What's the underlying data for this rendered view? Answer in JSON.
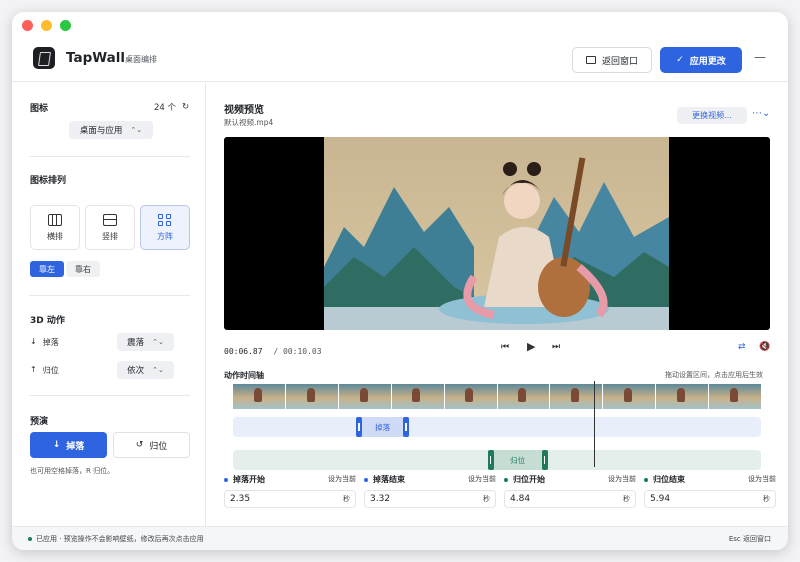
{
  "app": {
    "name": "TapWall",
    "subtitle": "桌面编排"
  },
  "header": {
    "back_label": "返回窗口",
    "apply_label": "应用更改",
    "more": "—"
  },
  "sidebar": {
    "icons_title": "图标",
    "icons_count": "24 个",
    "scope_select": "桌面与应用",
    "layout_title": "图标排列",
    "layouts": [
      {
        "label": "横排",
        "icon": "columns-icon"
      },
      {
        "label": "竖排",
        "icon": "rows-icon"
      },
      {
        "label": "方阵",
        "icon": "grid-icon"
      }
    ],
    "align": [
      "靠左",
      "靠右"
    ],
    "motion_title": "3D 动作",
    "drop_label": "掉落",
    "drop_value": "震落",
    "restore_label": "归位",
    "restore_value": "依次",
    "preview_title": "预演",
    "drop_button": "掉落",
    "restore_button": "归位",
    "hint": "也可用空格掉落，R 归位。"
  },
  "main": {
    "preview_title": "视频预览",
    "file_name": "默认视频.mp4",
    "change_button": "更换视频...",
    "time_current": "00:06.87",
    "time_total": "/ 00:10.03",
    "timeline_title": "动作时间轴",
    "timeline_hint": "拖动设置区间，点击应用后生效",
    "drop_clip": "掉落",
    "restore_clip": "归位",
    "playhead_fraction": 0.684,
    "drop_clip_range": [
      0.235,
      0.332
    ],
    "restore_clip_range": [
      0.484,
      0.594
    ],
    "fields": [
      {
        "label": "掉落开始",
        "set": "设为当前",
        "value": "2.35",
        "unit": "秒",
        "color": "#2f64e0"
      },
      {
        "label": "掉落结束",
        "set": "设为当前",
        "value": "3.32",
        "unit": "秒",
        "color": "#2f64e0"
      },
      {
        "label": "归位开始",
        "set": "设为当前",
        "value": "4.84",
        "unit": "秒",
        "color": "#1f7a5c"
      },
      {
        "label": "归位结束",
        "set": "设为当前",
        "value": "5.94",
        "unit": "秒",
        "color": "#1f7a5c"
      }
    ]
  },
  "footer": {
    "status": "已应用 · 预览操作不会影响壁纸，修改后再次点击应用",
    "shortcut": "Esc 返回窗口",
    "status_color": "#1f7a5c"
  },
  "colors": {
    "accent": "#2f64e0",
    "restore": "#1f7a5c"
  }
}
